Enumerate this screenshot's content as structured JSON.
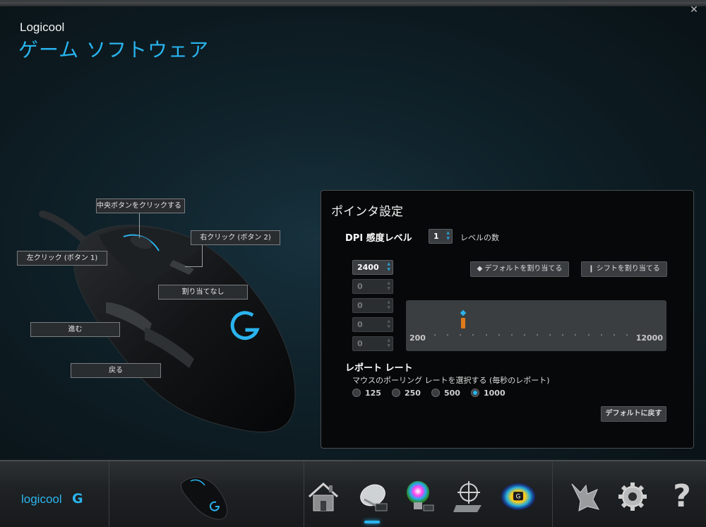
{
  "app": {
    "brand_small": "Logicool",
    "brand_title": "ゲーム ソフトウェア",
    "close_glyph": "✕"
  },
  "mouse_callouts": {
    "middle": "中央ボタンをクリックする (ボタ",
    "right": "右クリック (ボタン 2)",
    "left": "左クリック (ボタン 1)",
    "unassigned": "割り当てなし",
    "forward": "進む",
    "back": "戻る"
  },
  "panel": {
    "title": "ポインタ設定",
    "dpi_label": "DPI 感度レベル",
    "level_count": "1",
    "levels_label": "レベルの数",
    "dpi_values": [
      "2400",
      "0",
      "0",
      "0",
      "0"
    ],
    "default_button": "◆ デフォルトを割り当てる",
    "shift_button": "❙ シフトを割り当てる",
    "slider_min": "200",
    "slider_max": "12000",
    "slider_current_fraction": 0.186,
    "report_title": "レポート レート",
    "report_subtitle": "マウスのポーリング レートを選択する (毎秒のレポート)",
    "report_options": [
      "125",
      "250",
      "500",
      "1000"
    ],
    "report_selected": "1000",
    "reset_button": "デフォルトに戻す"
  },
  "bottombar": {
    "logo_text": "logicool",
    "logo_mark": "G",
    "icons": [
      "home-icon",
      "mouse-settings-icon",
      "lighting-icon",
      "pointer-settings-icon",
      "heatmap-icon",
      "arx-control-icon",
      "gear-icon",
      "help-icon"
    ],
    "help_glyph": "?"
  },
  "colors": {
    "accent": "#2ab4ee",
    "marker": "#e07a1a",
    "panel_bg": "#070809"
  }
}
